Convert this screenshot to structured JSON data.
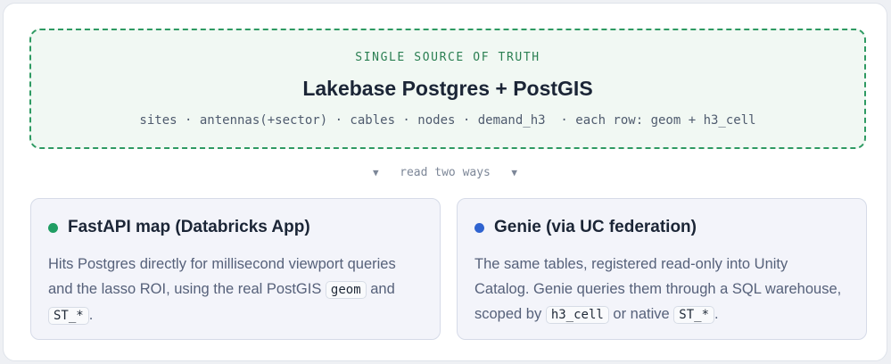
{
  "source": {
    "eyebrow": "SINGLE SOURCE OF TRUTH",
    "title": "Lakebase Postgres + PostGIS",
    "tables": "sites · antennas(+sector) · cables · nodes · demand_h3  · each row: geom + h3_cell",
    "border_color": "#2e9a62"
  },
  "connector": {
    "arrow": "▼",
    "label": "read two ways"
  },
  "cards": [
    {
      "title": "FastAPI map (Databricks App)",
      "dot_color": "#1f9d63",
      "body_1": "Hits Postgres directly for millisecond viewport queries and the lasso ROI, using the real PostGIS ",
      "code_1": "geom",
      "body_2": " and ",
      "code_2": "ST_*",
      "body_3": "."
    },
    {
      "title": "Genie (via UC federation)",
      "dot_color": "#2f63d0",
      "body_1": "The same tables, registered read-only into Unity Catalog. Genie queries them through a SQL warehouse, scoped by ",
      "code_1": "h3_cell",
      "body_2": " or native ",
      "code_2": "ST_*",
      "body_3": "."
    }
  ]
}
